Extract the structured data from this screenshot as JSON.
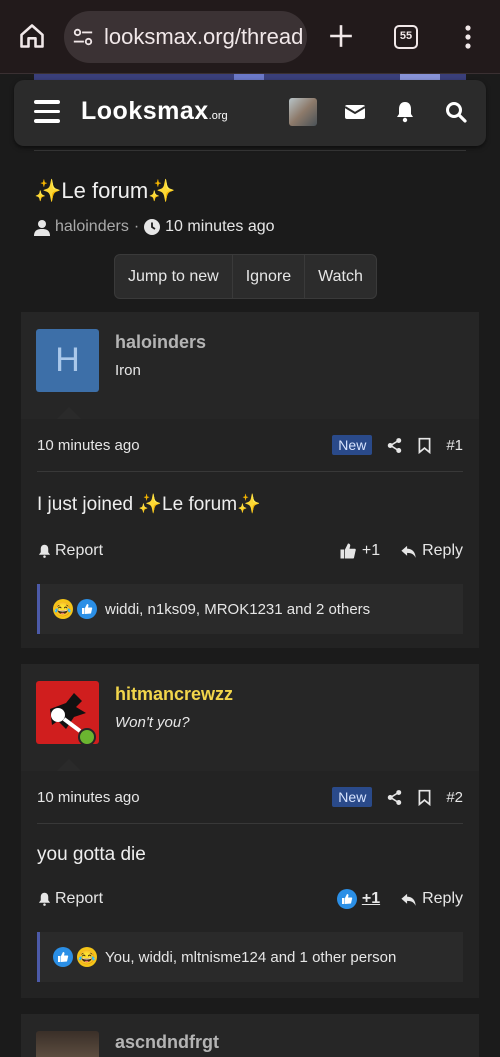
{
  "browser": {
    "url": "looksmax.org/thread",
    "tab_count": "55"
  },
  "site": {
    "logo_text": "Looksmax",
    "logo_tld": ".org"
  },
  "thread": {
    "title": "✨Le forum✨",
    "author": "haloinders",
    "meta_sep": "·",
    "time": "10 minutes ago",
    "buttons": [
      "Jump to new",
      "Ignore",
      "Watch"
    ]
  },
  "posts": [
    {
      "username": "haloinders",
      "username_color": "#b4b4b4",
      "user_title": "Iron",
      "avatar_letter": "H",
      "avatar_color": "#3d6fa8",
      "time": "10 minutes ago",
      "badge": "New",
      "number": "#1",
      "body": "I just joined ✨Le forum✨",
      "report_label": "Report",
      "like_label": "+1",
      "reply_label": "Reply",
      "reactions_text": "widdi, n1ks09, MROK1231 and 2 others"
    },
    {
      "username": "hitmancrewzz",
      "username_color": "#f2d64b",
      "user_title": "Won't you?",
      "avatar_color": "#d01e1e",
      "time": "10 minutes ago",
      "badge": "New",
      "number": "#2",
      "body": "you gotta die",
      "report_label": "Report",
      "like_label": "+1",
      "reply_label": "Reply",
      "reactions_text": "You, widdi, mltnisme124 and 1 other person"
    },
    {
      "username": "ascndndfrgt",
      "username_color": "#b4b4b4"
    }
  ]
}
